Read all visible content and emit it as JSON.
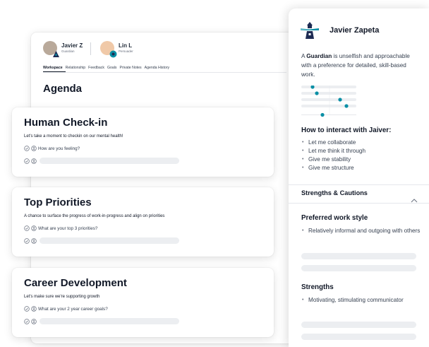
{
  "header": {
    "users": [
      {
        "name": "Javier Z",
        "role": "Guardian"
      },
      {
        "name": "Lin L",
        "role": "Persuader"
      }
    ],
    "tabs": [
      "Workspace",
      "Relationship",
      "Feedback",
      "Goals",
      "Private Notes",
      "Agenda History"
    ],
    "active_tab": "Workspace"
  },
  "agenda": {
    "title": "Agenda",
    "cards": [
      {
        "title": "Human Check-in",
        "subtitle": "Let's take a moment to checkin on our mental health!",
        "question": "How are you feeling?"
      },
      {
        "title": "Top Priorities",
        "subtitle": "A chance to surface the progress of work-in-progress and align on priorities",
        "question": "What are your top 3 priorities?"
      },
      {
        "title": "Career Development",
        "subtitle": "Let's make sure we're supporting growth",
        "question": "What are your 2 year career goals?"
      }
    ]
  },
  "profile": {
    "name": "Javier Zapeta",
    "desc_prefix": "A ",
    "type": "Guardian",
    "desc_rest": " is unselfish and approachable with a preference for detailed, skill-based work.",
    "interact_title": "How to interact with Jaiver:",
    "interact_items": [
      "Let me collaborate",
      "Let me think it through",
      "Give me stability",
      "Give me structure"
    ],
    "strengths_title": "Strengths & Cautions",
    "preferred_title": "Preferred work style",
    "preferred_items": [
      "Relatively informal and outgoing with others"
    ],
    "strengths_sub": "Strengths",
    "strengths_items": [
      "Motivating, stimulating communicator"
    ]
  },
  "colors": {
    "accent": "#0a8fa5",
    "navy": "#1d2b53",
    "skeleton": "#eceef1"
  },
  "icons": [
    "check-circle-icon",
    "person-circle-icon",
    "chevron-up-icon",
    "lighthouse-logo-icon",
    "persuader-badge-icon"
  ]
}
